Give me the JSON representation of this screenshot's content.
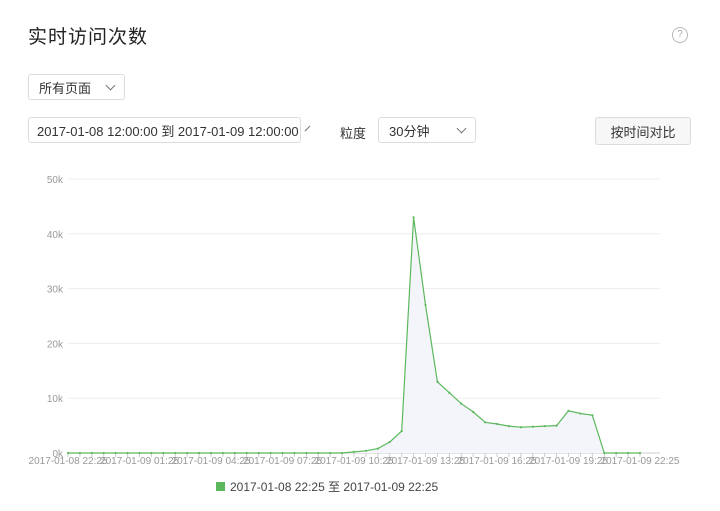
{
  "header": {
    "title": "实时访问次数",
    "help_icon": "question-circle-icon",
    "help_glyph": "?"
  },
  "filters": {
    "page_select": "所有页面",
    "date_range": "2017-01-08 12:00:00 到 2017-01-09 12:00:00",
    "granularity_label": "粒度",
    "granularity_select": "30分钟",
    "compare_button": "按时间对比"
  },
  "chart_data": {
    "type": "area",
    "title": "",
    "xlabel": "",
    "ylabel": "",
    "ylim": [
      0,
      50000
    ],
    "yticks": [
      0,
      10000,
      20000,
      30000,
      40000,
      50000
    ],
    "ytick_labels": [
      "0k",
      "10k",
      "20k",
      "30k",
      "40k",
      "50k"
    ],
    "xtick_labels": [
      "2017-01-08 22:25",
      "2017-01-09 01:25",
      "2017-01-09 04:25",
      "2017-01-09 07:25",
      "2017-01-09 10:25",
      "2017-01-09 13:25",
      "2017-01-09 16:25",
      "2017-01-09 19:25",
      "2017-01-09 22:25"
    ],
    "x": [
      "2017-01-08 22:25",
      "2017-01-08 22:55",
      "2017-01-08 23:25",
      "2017-01-08 23:55",
      "2017-01-09 00:25",
      "2017-01-09 00:55",
      "2017-01-09 01:25",
      "2017-01-09 01:55",
      "2017-01-09 02:25",
      "2017-01-09 02:55",
      "2017-01-09 03:25",
      "2017-01-09 03:55",
      "2017-01-09 04:25",
      "2017-01-09 04:55",
      "2017-01-09 05:25",
      "2017-01-09 05:55",
      "2017-01-09 06:25",
      "2017-01-09 06:55",
      "2017-01-09 07:25",
      "2017-01-09 07:55",
      "2017-01-09 08:25",
      "2017-01-09 08:55",
      "2017-01-09 09:25",
      "2017-01-09 09:55",
      "2017-01-09 10:25",
      "2017-01-09 10:55",
      "2017-01-09 11:25",
      "2017-01-09 11:55",
      "2017-01-09 12:25",
      "2017-01-09 12:55",
      "2017-01-09 13:25",
      "2017-01-09 13:55",
      "2017-01-09 14:25",
      "2017-01-09 14:55",
      "2017-01-09 15:25",
      "2017-01-09 15:55",
      "2017-01-09 16:25",
      "2017-01-09 16:55",
      "2017-01-09 17:25",
      "2017-01-09 17:55",
      "2017-01-09 18:25",
      "2017-01-09 18:55",
      "2017-01-09 19:25",
      "2017-01-09 19:55",
      "2017-01-09 20:25",
      "2017-01-09 20:55",
      "2017-01-09 21:25",
      "2017-01-09 21:55",
      "2017-01-09 22:25"
    ],
    "series": [
      {
        "name": "2017-01-08 22:25 至 2017-01-09 22:25",
        "color": "#5cb85c",
        "fill": "#f3f5fb",
        "values": [
          0,
          0,
          0,
          0,
          0,
          0,
          0,
          0,
          0,
          0,
          0,
          0,
          0,
          0,
          0,
          0,
          0,
          0,
          0,
          0,
          0,
          0,
          0,
          0,
          200,
          400,
          800,
          2000,
          4000,
          43000,
          27000,
          13000,
          11000,
          9000,
          7500,
          5600,
          5300,
          4900,
          4700,
          4800,
          4900,
          5000,
          7700,
          7200,
          6900,
          0,
          0,
          0,
          0
        ]
      }
    ],
    "grid": true,
    "legend": "bottom"
  }
}
